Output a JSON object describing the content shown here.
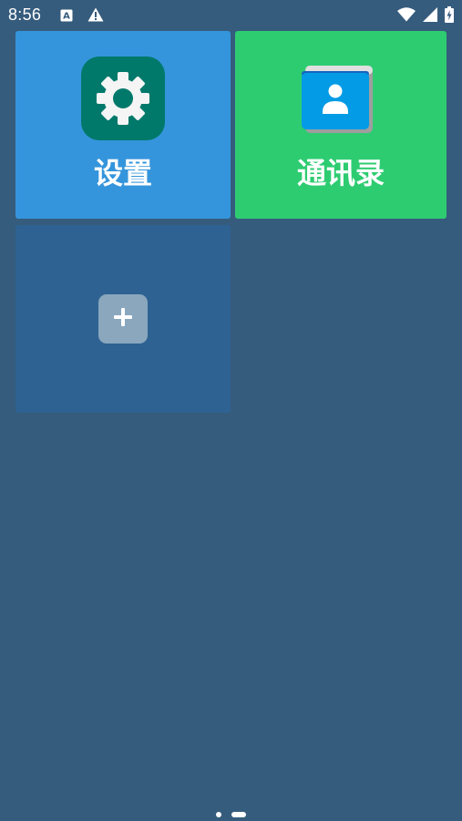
{
  "status_bar": {
    "time": "8:56",
    "left_icons": [
      "a-notification-icon",
      "warning-icon"
    ],
    "right_icons": [
      "wifi-icon",
      "cell-signal-icon",
      "battery-charging-icon"
    ]
  },
  "tiles": [
    {
      "label": "设置",
      "icon": "settings-gear-icon",
      "background": "#3595dc",
      "icon_background": "#00796b"
    },
    {
      "label": "通讯录",
      "icon": "contacts-icon",
      "background": "#2ecc71",
      "icon_background": "#039be5"
    },
    {
      "label": "",
      "icon": "add-icon",
      "background": "#2e6292",
      "button_background": "#8aa7bd"
    }
  ],
  "page_indicator": {
    "pages": 2,
    "current": 2
  },
  "colors": {
    "wallpaper": "#365c7d",
    "text": "#ffffff"
  }
}
